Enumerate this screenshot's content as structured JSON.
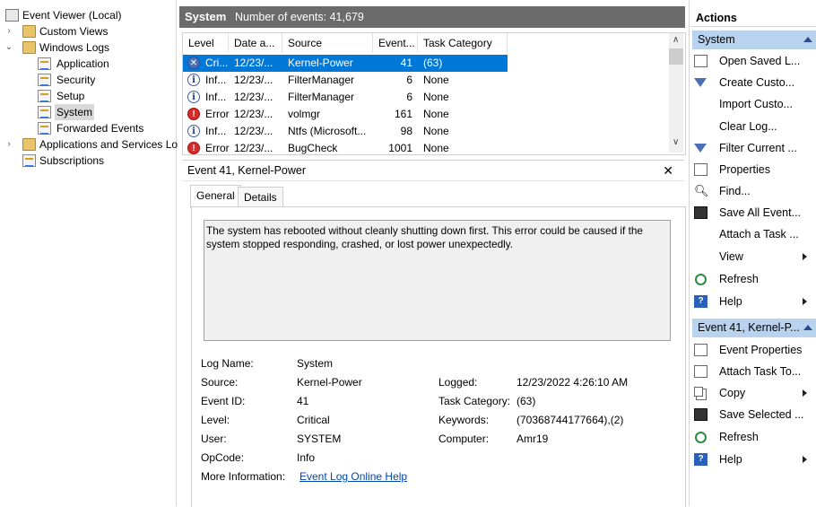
{
  "tree": {
    "items": [
      {
        "label": "Event Viewer (Local)"
      },
      {
        "label": "Custom Views"
      },
      {
        "label": "Windows Logs"
      },
      {
        "label": "Application"
      },
      {
        "label": "Security"
      },
      {
        "label": "Setup"
      },
      {
        "label": "System"
      },
      {
        "label": "Forwarded Events"
      },
      {
        "label": "Applications and Services Lo"
      },
      {
        "label": "Subscriptions"
      }
    ]
  },
  "center": {
    "title": "System",
    "event_count": "Number of events: 41,679"
  },
  "grid": {
    "columns": [
      "Level",
      "Date a...",
      "Source",
      "Event...",
      "Task Category"
    ],
    "rows": [
      {
        "level": "Cri...",
        "date": "12/23/...",
        "source": "Kernel-Power",
        "event": "41",
        "task": "(63)",
        "icon": "critical-icon"
      },
      {
        "level": "Inf...",
        "date": "12/23/...",
        "source": "FilterManager",
        "event": "6",
        "task": "None",
        "icon": "info-icon"
      },
      {
        "level": "Inf...",
        "date": "12/23/...",
        "source": "FilterManager",
        "event": "6",
        "task": "None",
        "icon": "info-icon"
      },
      {
        "level": "Error",
        "date": "12/23/...",
        "source": "volmgr",
        "event": "161",
        "task": "None",
        "icon": "error-icon"
      },
      {
        "level": "Inf...",
        "date": "12/23/...",
        "source": "Ntfs (Microsoft...",
        "event": "98",
        "task": "None",
        "icon": "info-icon"
      },
      {
        "level": "Error",
        "date": "12/23/...",
        "source": "BugCheck",
        "event": "1001",
        "task": "None",
        "icon": "error-icon"
      }
    ]
  },
  "details": {
    "title": "Event 41, Kernel-Power",
    "close": "✕",
    "tabs": [
      "General",
      "Details"
    ],
    "description": "The system has rebooted without cleanly shutting down first. This error could be caused if the system stopped responding, crashed, or lost power unexpectedly.",
    "fields": {
      "log_name_label": "Log Name:",
      "log_name": "System",
      "source_label": "Source:",
      "source": "Kernel-Power",
      "logged_label": "Logged:",
      "logged": "12/23/2022 4:26:10 AM",
      "event_id_label": "Event ID:",
      "event_id": "41",
      "task_category_label": "Task Category:",
      "task_category": "(63)",
      "level_label": "Level:",
      "level": "Critical",
      "keywords_label": "Keywords:",
      "keywords": "(70368744177664),(2)",
      "user_label": "User:",
      "user": "SYSTEM",
      "computer_label": "Computer:",
      "computer": "Amr19",
      "opcode_label": "OpCode:",
      "opcode": "Info",
      "more_info_label": "More Information:",
      "more_info_link": "Event Log Online Help"
    }
  },
  "actions": {
    "title": "Actions",
    "group1": "System",
    "group1_items": [
      "Open Saved L...",
      "Create Custo...",
      "Import Custo...",
      "Clear Log...",
      "Filter Current ...",
      "Properties",
      "Find...",
      "Save All Event...",
      "Attach a Task ...",
      "View",
      "Refresh",
      "Help"
    ],
    "group2": "Event 41, Kernel-P...",
    "group2_items": [
      "Event Properties",
      "Attach Task To...",
      "Copy",
      "Save Selected ...",
      "Refresh",
      "Help"
    ]
  },
  "colors": {
    "selection": "#0078d7",
    "group_header": "#b9d3ef",
    "center_header": "#6b6b6b"
  }
}
